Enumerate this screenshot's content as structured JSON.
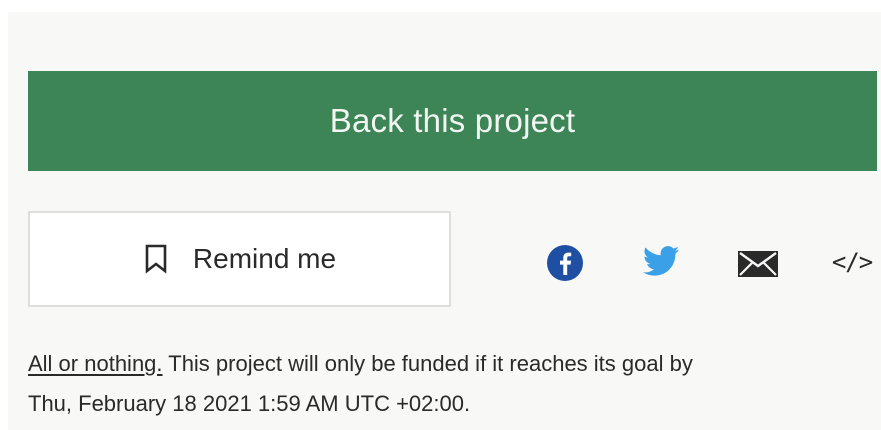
{
  "back_button": {
    "label": "Back this project"
  },
  "remind_button": {
    "label": "Remind me",
    "icon": "bookmark-icon"
  },
  "share": {
    "icons": [
      "facebook-icon",
      "twitter-icon",
      "mail-icon",
      "embed-icon"
    ],
    "embed_glyph": "</>"
  },
  "funding_note": {
    "link_text": "All or nothing.",
    "text_line1": "This project will only be funded if it reaches its goal by",
    "text_line2": "Thu, February 18 2021 1:59 AM UTC +02:00."
  },
  "colors": {
    "primary_green": "#3d8556",
    "facebook_blue": "#1f4fa3",
    "twitter_blue": "#3aa0e8",
    "text": "#2a2a2a",
    "panel_background": "#f8f8f6",
    "button_border": "#dedede"
  }
}
